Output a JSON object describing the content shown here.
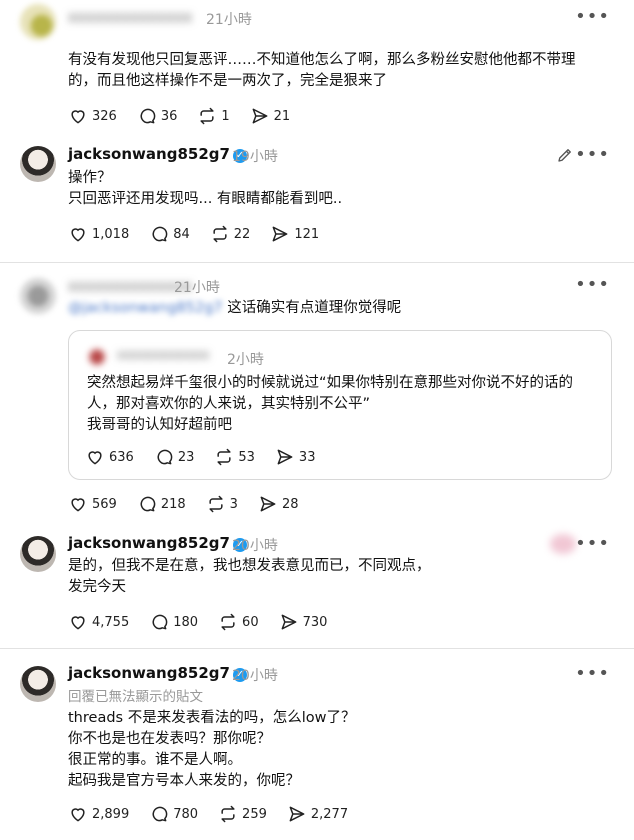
{
  "posts": [
    {
      "username": "xxxxxxxxxxxxxx",
      "time": "21小時",
      "text_lines": [
        "有没有发现他只回复恶评……不知道他怎么了啊，那么多粉丝安慰他他都不带理",
        "的，而且他这样操作不是一两次了，完全是狠来了"
      ],
      "likes": "326",
      "comments": "36",
      "reposts": "1",
      "shares": "21"
    },
    {
      "username": "jacksonwang852g7",
      "time": "19小時",
      "text_lines": [
        "操作？",
        "只回恶评还用发现吗... 有眼睛都能看到吧.."
      ],
      "likes": "1,018",
      "comments": "84",
      "reposts": "22",
      "shares": "121"
    },
    {
      "username": "xxxxxxxxxxxxxx",
      "time": "21小時",
      "mention": "@jacksonwang852g7",
      "text": "这话确实有点道理你觉得呢",
      "quote": {
        "username": "xxxxxxxxxxxx",
        "time": "2小時",
        "text_lines": [
          "突然想起易烊千玺很小的时候就说过“如果你特别在意那些对你说不好的话的",
          "人，那对喜欢你的人来说，其实特别不公平”",
          "我哥哥的认知好超前吧"
        ],
        "likes": "636",
        "comments": "23",
        "reposts": "53",
        "shares": "33"
      },
      "likes": "569",
      "comments": "218",
      "reposts": "3",
      "shares": "28"
    },
    {
      "username": "jacksonwang852g7",
      "time": "20小時",
      "text_lines": [
        "是的，但我不是在意，我也想发表意见而已，不同观点，",
        "发完今天"
      ],
      "likes": "4,755",
      "comments": "180",
      "reposts": "60",
      "shares": "730"
    },
    {
      "username": "jacksonwang852g7",
      "time": "20小時",
      "subtitle": "回覆已無法顯示的貼文",
      "text_lines": [
        "threads 不是来发表看法的吗，怎么low了？",
        "你不也是也在发表吗？那你呢？",
        "很正常的事。谁不是人啊。",
        "起码我是官方号本人来发的，你呢？"
      ],
      "likes": "2,899",
      "comments": "780",
      "reposts": "259",
      "shares": "2,277"
    }
  ],
  "icons": {
    "like": "heart-icon",
    "comment": "comment-icon",
    "repost": "repost-icon",
    "share": "share-icon",
    "more": "more-icon",
    "edit": "edit-icon",
    "verified": "verified-badge-icon"
  },
  "colors": {
    "verified": "#1d9bf0",
    "muted": "#999999",
    "divider": "#e2e2e2"
  }
}
